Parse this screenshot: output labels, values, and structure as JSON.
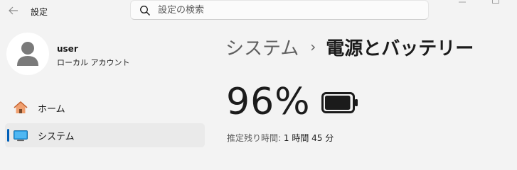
{
  "titlebar": {
    "back_icon": "back-arrow-icon",
    "title": "設定",
    "search": {
      "placeholder": "設定の検索",
      "value": "",
      "icon": "search-icon"
    }
  },
  "user": {
    "name": "user",
    "account_type": "ローカル アカウント",
    "avatar_icon": "person-icon"
  },
  "sidebar": {
    "items": [
      {
        "label": "ホーム",
        "icon": "home-icon",
        "active": false
      },
      {
        "label": "システム",
        "icon": "system-display-icon",
        "active": true
      }
    ]
  },
  "main": {
    "breadcrumb": {
      "parent": "システム",
      "separator": "›",
      "current": "電源とバッテリー"
    },
    "battery": {
      "percent_text": "96%",
      "level": 0.96,
      "icon": "battery-icon"
    },
    "remaining": {
      "label": "推定残り時間:",
      "value": "1 時間 45 分"
    }
  },
  "colors": {
    "background": "#f3f3f3",
    "accent": "#005fb8",
    "home_icon": "#e8743b",
    "system_icon": "#0a84d6"
  }
}
